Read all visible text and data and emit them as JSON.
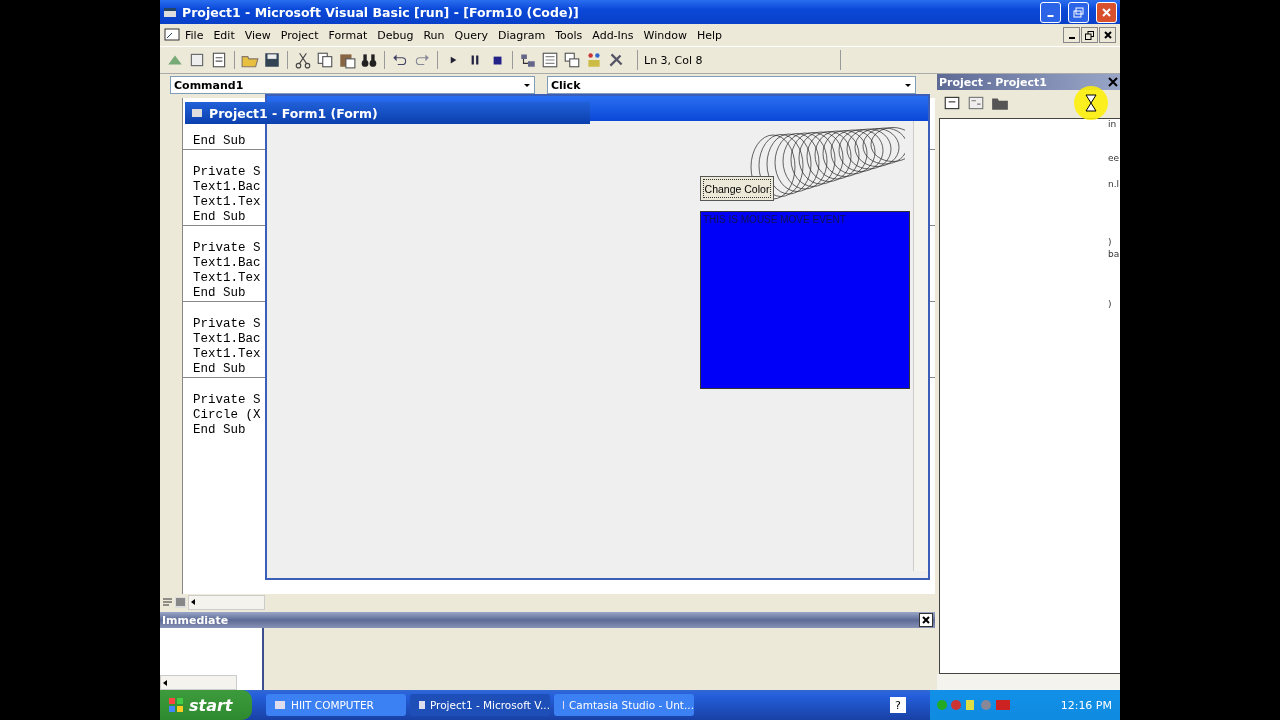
{
  "window": {
    "title": "Project1 - Microsoft Visual Basic [run] - [Form10 (Code)]"
  },
  "menu": [
    "File",
    "Edit",
    "View",
    "Project",
    "Format",
    "Debug",
    "Run",
    "Query",
    "Diagram",
    "Tools",
    "Add-Ins",
    "Window",
    "Help"
  ],
  "toolbar": {
    "status": "Ln 3, Col 8"
  },
  "code_window": {
    "object": "Command1",
    "procedure": "Click",
    "procedures": [
      [
        "End Sub"
      ],
      [
        "Private S",
        "Text1.Bac",
        "Text1.Tex",
        "End Sub"
      ],
      [
        "Private S",
        "Text1.Bac",
        "Text1.Tex",
        "End Sub"
      ],
      [
        "Private S",
        "Text1.Bac",
        "Text1.Tex",
        "End Sub"
      ],
      [
        "Private S",
        "Circle (X",
        "End Sub"
      ]
    ]
  },
  "form_window": {
    "title": "Project1 - Form1 (Form)",
    "button": "Change Color",
    "textbox": "THIS IS MOUSE MOVE EVENT"
  },
  "immediate": {
    "title": "Immediate"
  },
  "project_explorer": {
    "title": "Project - Project1",
    "fragments": [
      "in",
      "ee",
      "n.l",
      ")",
      "ba",
      ")"
    ]
  },
  "taskbar": {
    "start": "start",
    "buttons": [
      {
        "label": "HIIT COMPUTER",
        "selected": false
      },
      {
        "label": "Project1 - Microsoft V...",
        "selected": true
      },
      {
        "label": "Camtasia Studio - Unt...",
        "selected": false
      }
    ],
    "help": "?",
    "clock": "12:16 PM"
  }
}
